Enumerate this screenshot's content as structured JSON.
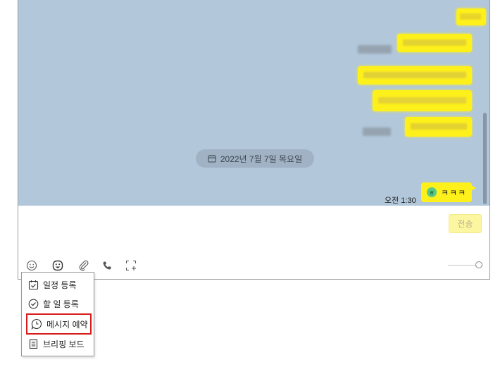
{
  "chat": {
    "date_divider": "2022년 7월 7일 목요일",
    "my_message": {
      "time": "오전 1:30",
      "emoji": "ㅎ",
      "text": "ㅋㅋㅋ"
    },
    "bubble_color": "#fef01b",
    "background_color": "#b2c7da"
  },
  "composer": {
    "send_label": "전송"
  },
  "toolbar": {
    "icons": [
      "emoticon-icon",
      "sticker-icon",
      "attach-icon",
      "phone-icon",
      "capture-icon"
    ]
  },
  "popup_menu": {
    "items": [
      {
        "label": "일정 등록",
        "icon": "calendar-check-icon"
      },
      {
        "label": "할 일 등록",
        "icon": "check-circle-icon"
      },
      {
        "label": "메시지 예약",
        "icon": "clock-bubble-icon",
        "highlighted": true
      },
      {
        "label": "브리핑 보드",
        "icon": "document-icon"
      }
    ],
    "highlight_color": "#d81b1b"
  }
}
